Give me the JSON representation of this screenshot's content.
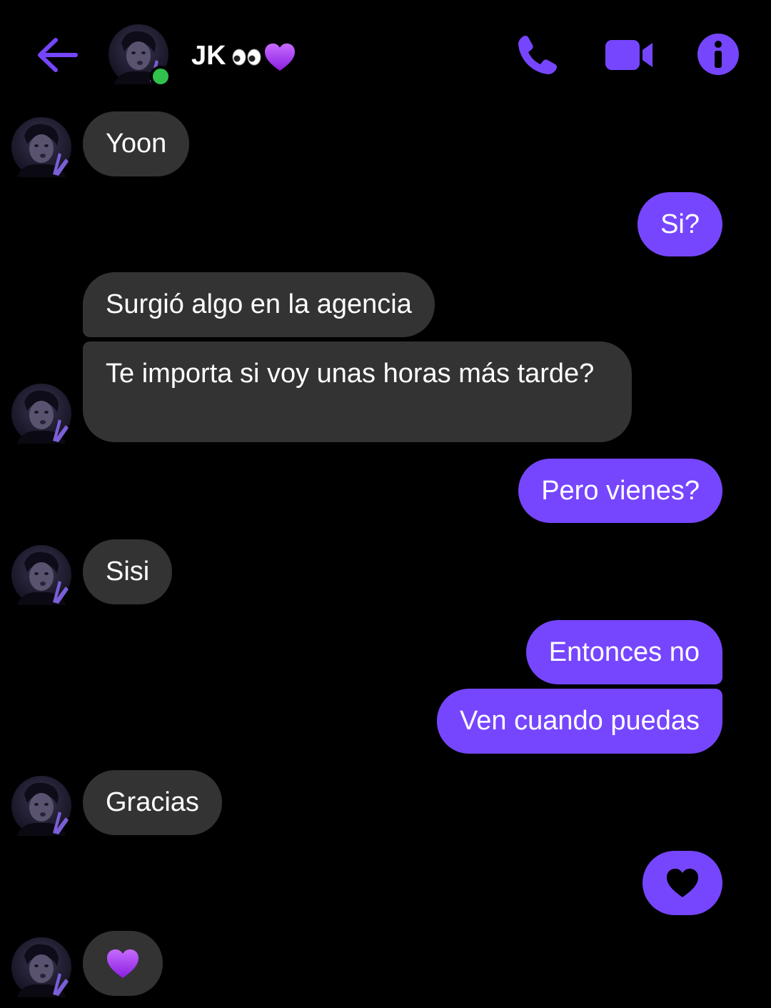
{
  "header": {
    "contact_name": "JK",
    "status": "online",
    "name_emojis": [
      "eyes-emoji",
      "purple-heart-emoji"
    ]
  },
  "colors": {
    "accent": "#7646ff",
    "incoming_bubble": "#333333",
    "online_dot": "#31c24d",
    "background": "#000000"
  },
  "messages": [
    {
      "from": "them",
      "text": "Yoon"
    },
    {
      "from": "me",
      "text": "Si?"
    },
    {
      "from": "them",
      "text": "Surgió algo en la agencia"
    },
    {
      "from": "them",
      "text": "Te importa si voy unas horas más tarde?"
    },
    {
      "from": "me",
      "text": "Pero vienes?"
    },
    {
      "from": "them",
      "text": "Sisi"
    },
    {
      "from": "me",
      "text": "Entonces no"
    },
    {
      "from": "me",
      "text": "Ven cuando puedas"
    },
    {
      "from": "them",
      "text": "Gracias"
    },
    {
      "from": "me",
      "emoji": "black-heart-emoji"
    },
    {
      "from": "them",
      "emoji": "purple-heart-emoji"
    }
  ]
}
